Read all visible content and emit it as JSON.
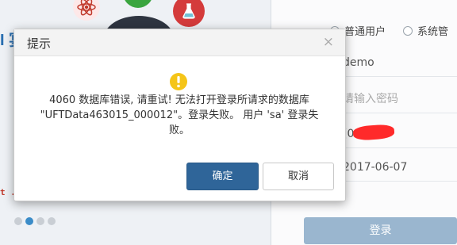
{
  "login": {
    "user_types": [
      {
        "label": "普通用户",
        "selected": true
      },
      {
        "label": "系统管",
        "selected": false
      }
    ],
    "username_value": "demo",
    "password_placeholder": "请输入密码",
    "account_value": "[012",
    "date_value": "2017-06-07",
    "login_button": "登录"
  },
  "background": {
    "logo_fragment": "I 宴",
    "red_text_fragment": "t .",
    "carousel": {
      "count": 4,
      "active_index": 1
    }
  },
  "dialog": {
    "title": "提示",
    "close_glyph": "×",
    "icon": "warning-icon",
    "message_lines": [
      "4060 数据库错误, 请重试! 无法打开登录所请求的数据库",
      "\"UFTData463015_000012\"。登录失败。 用户 'sa' 登录失",
      "败。"
    ],
    "ok_label": "确定",
    "cancel_label": "取消"
  },
  "colors": {
    "primary_button": "#2f6599",
    "login_button": "#9ab6cf",
    "warning": "#f5c518",
    "redaction": "#ff2a2a"
  }
}
